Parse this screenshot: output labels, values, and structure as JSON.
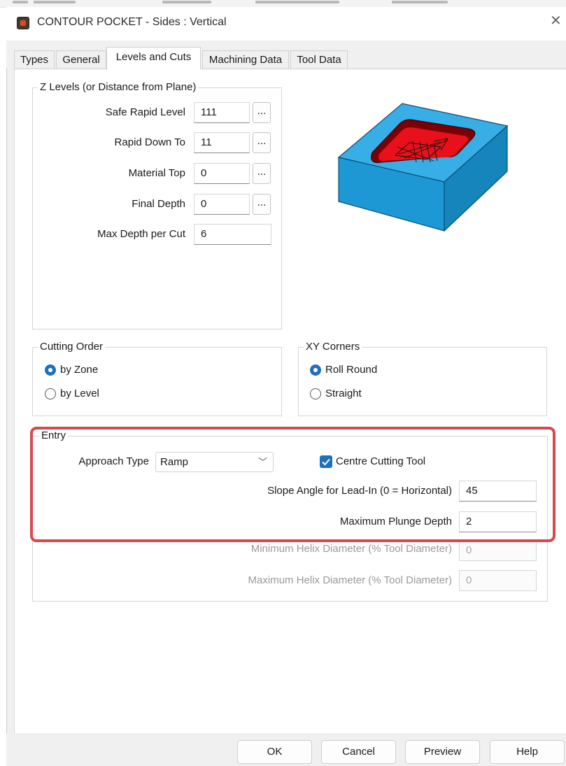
{
  "window": {
    "title": "CONTOUR POCKET - Sides : Vertical"
  },
  "tabs": [
    {
      "label": "Types"
    },
    {
      "label": "General"
    },
    {
      "label": "Levels and Cuts"
    },
    {
      "label": "Machining Data"
    },
    {
      "label": "Tool Data"
    }
  ],
  "active_tab": "Levels and Cuts",
  "z_levels": {
    "title": "Z Levels (or Distance from Plane)",
    "rows": [
      {
        "label": "Safe Rapid Level",
        "value": "111",
        "browse": "..."
      },
      {
        "label": "Rapid Down To",
        "value": "11",
        "browse": "..."
      },
      {
        "label": "Material Top",
        "value": "0",
        "browse": "..."
      },
      {
        "label": "Final Depth",
        "value": "0",
        "browse": "..."
      },
      {
        "label": "Max Depth per Cut",
        "value": "6"
      }
    ]
  },
  "preview_icon": "pocket-3d-preview",
  "colors": {
    "block": "#1f9ad6",
    "pocket": "#e8101a",
    "highlight": "#d9484b",
    "accent": "#1f6fbf"
  },
  "cutting_order": {
    "title": "Cutting Order",
    "options": [
      {
        "label": "by Zone",
        "selected": true
      },
      {
        "label": "by Level",
        "selected": false
      }
    ]
  },
  "xy_corners": {
    "title": "XY Corners",
    "options": [
      {
        "label": "Roll Round",
        "selected": true
      },
      {
        "label": "Straight",
        "selected": false
      }
    ]
  },
  "entry": {
    "title": "Entry",
    "approach_label": "Approach Type",
    "approach_value": "Ramp",
    "centre_cutting_label": "Centre Cutting Tool",
    "centre_cutting_checked": true,
    "slope_label": "Slope Angle for Lead-In (0 = Horizontal)",
    "slope_value": "45",
    "plunge_label": "Maximum Plunge Depth",
    "plunge_value": "2",
    "min_helix_label": "Minimum Helix Diameter (% Tool Diameter)",
    "min_helix_value": "0",
    "max_helix_label": "Maximum Helix Diameter (% Tool Diameter)",
    "max_helix_value": "0"
  },
  "buttons": {
    "ok": "OK",
    "cancel": "Cancel",
    "preview": "Preview",
    "help": "Help"
  }
}
